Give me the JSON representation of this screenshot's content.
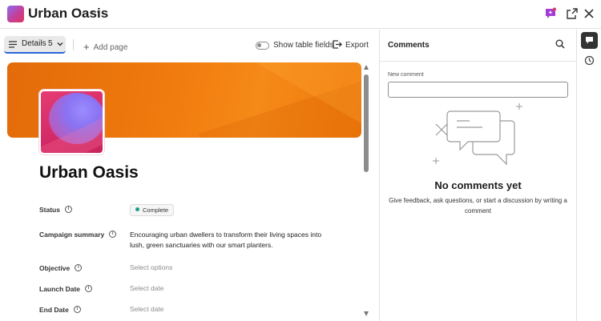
{
  "window": {
    "title": "Urban Oasis",
    "more_label": "···"
  },
  "toolbar": {
    "details_label": "Details",
    "details_count": "5",
    "add_page_label": "Add page",
    "table_fields_label": "Show table fields",
    "table_fields_enabled": false,
    "export_label": "Export"
  },
  "record": {
    "title": "Urban Oasis",
    "fields": {
      "status": {
        "label": "Status",
        "value": "Complete",
        "color": "#1a9e8c"
      },
      "summary": {
        "label": "Campaign summary",
        "value": "Encouraging urban dwellers to transform their living spaces into lush, green sanctuaries with our smart planters."
      },
      "objective": {
        "label": "Objective",
        "placeholder": "Select options"
      },
      "launch_date": {
        "label": "Launch Date",
        "placeholder": "Select date"
      },
      "end_date": {
        "label": "End Date",
        "placeholder": "Select date"
      }
    }
  },
  "comments": {
    "header": "Comments",
    "new_comment_label": "New comment",
    "new_comment_value": "",
    "empty_title": "No comments yet",
    "empty_desc": "Give feedback, ask questions, or start a discussion by writing a comment"
  },
  "colors": {
    "banner": "#f07a0d",
    "accent": "#2b66d8",
    "rail_active": "#333333"
  }
}
